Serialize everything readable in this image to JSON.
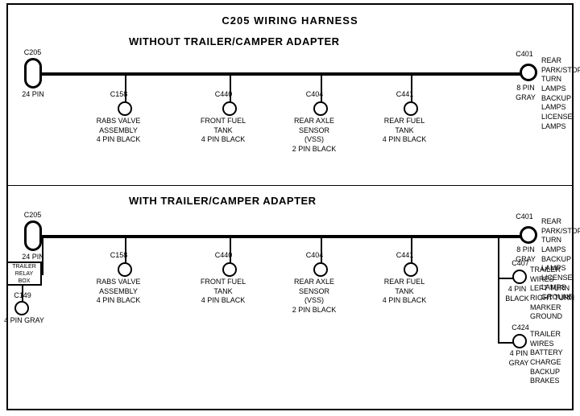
{
  "title": "C205 WIRING HARNESS",
  "section1": {
    "label": "WITHOUT TRAILER/CAMPER ADAPTER",
    "left_connector": {
      "id": "C205",
      "pin": "24 PIN"
    },
    "right_connector": {
      "id": "C401",
      "pin": "8 PIN",
      "color": "GRAY",
      "label": "REAR PARK/STOP\nTURN LAMPS\nBACKUP LAMPS\nLICENSE LAMPS"
    },
    "connectors": [
      {
        "id": "C158",
        "label": "RABS VALVE\nASSEMBLY\n4 PIN BLACK"
      },
      {
        "id": "C440",
        "label": "FRONT FUEL\nTANK\n4 PIN BLACK"
      },
      {
        "id": "C404",
        "label": "REAR AXLE\nSENSOR\n(VSS)\n2 PIN BLACK"
      },
      {
        "id": "C441",
        "label": "REAR FUEL\nTANK\n4 PIN BLACK"
      }
    ]
  },
  "section2": {
    "label": "WITH TRAILER/CAMPER ADAPTER",
    "left_connector": {
      "id": "C205",
      "pin": "24 PIN"
    },
    "right_connector": {
      "id": "C401",
      "pin": "8 PIN",
      "color": "GRAY",
      "label": "REAR PARK/STOP\nTURN LAMPS\nBACKUP LAMPS\nLICENSE LAMPS\nGROUND"
    },
    "extra_left": {
      "box_label": "TRAILER\nRELAY\nBOX",
      "id": "C149",
      "pin": "4 PIN GRAY"
    },
    "connectors": [
      {
        "id": "C158",
        "label": "RABS VALVE\nASSEMBLY\n4 PIN BLACK"
      },
      {
        "id": "C440",
        "label": "FRONT FUEL\nTANK\n4 PIN BLACK"
      },
      {
        "id": "C404",
        "label": "REAR AXLE\nSENSOR\n(VSS)\n2 PIN BLACK"
      },
      {
        "id": "C441",
        "label": "REAR FUEL\nTANK\n4 PIN BLACK"
      }
    ],
    "right_extras": [
      {
        "id": "C407",
        "pin": "4 PIN\nBLACK",
        "label": "TRAILER WIRES\nLEFT TURN\nRIGHT TURN\nMARKER\nGROUND"
      },
      {
        "id": "C424",
        "pin": "4 PIN\nGRAY",
        "label": "TRAILER WIRES\nBATTERY CHARGE\nBACKUP\nBRAKES"
      }
    ]
  }
}
